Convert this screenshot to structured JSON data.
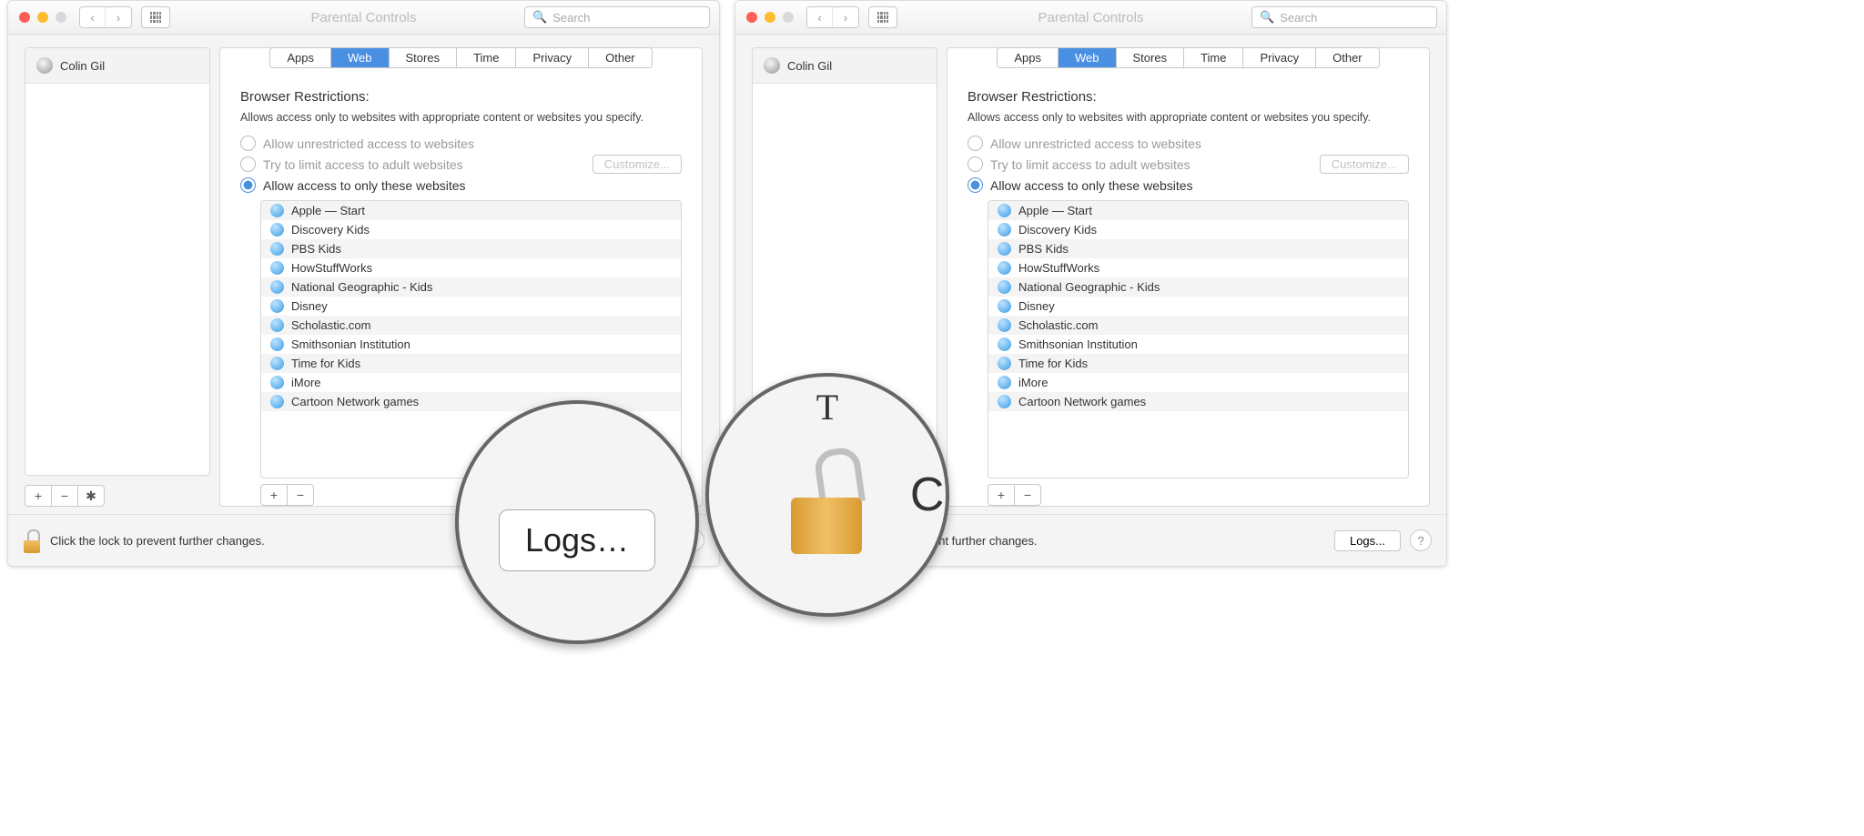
{
  "title": "Parental Controls",
  "search_placeholder": "Search",
  "user_name": "Colin Gil",
  "tabs": {
    "apps": "Apps",
    "web": "Web",
    "stores": "Stores",
    "time": "Time",
    "privacy": "Privacy",
    "other": "Other"
  },
  "section_title": "Browser Restrictions:",
  "help_text": "Allows access only to websites with appropriate content or websites you specify.",
  "radios": {
    "unrestricted": "Allow unrestricted access to websites",
    "limit_adult": "Try to limit access to adult websites",
    "only_these": "Allow access to only these websites"
  },
  "customize_label": "Customize...",
  "sites": [
    "Apple — Start",
    "Discovery Kids",
    "PBS Kids",
    "HowStuffWorks",
    "National Geographic - Kids",
    "Disney",
    "Scholastic.com",
    "Smithsonian Institution",
    "Time for Kids",
    "iMore",
    "Cartoon Network games"
  ],
  "lock_text": "Click the lock to prevent further changes.",
  "lock_text_partial": "ent further changes.",
  "logs_label": "Logs...",
  "mag_a_text": "Logs…",
  "mag_b_text": "Cl",
  "plus": "+",
  "minus": "−",
  "help_q": "?"
}
